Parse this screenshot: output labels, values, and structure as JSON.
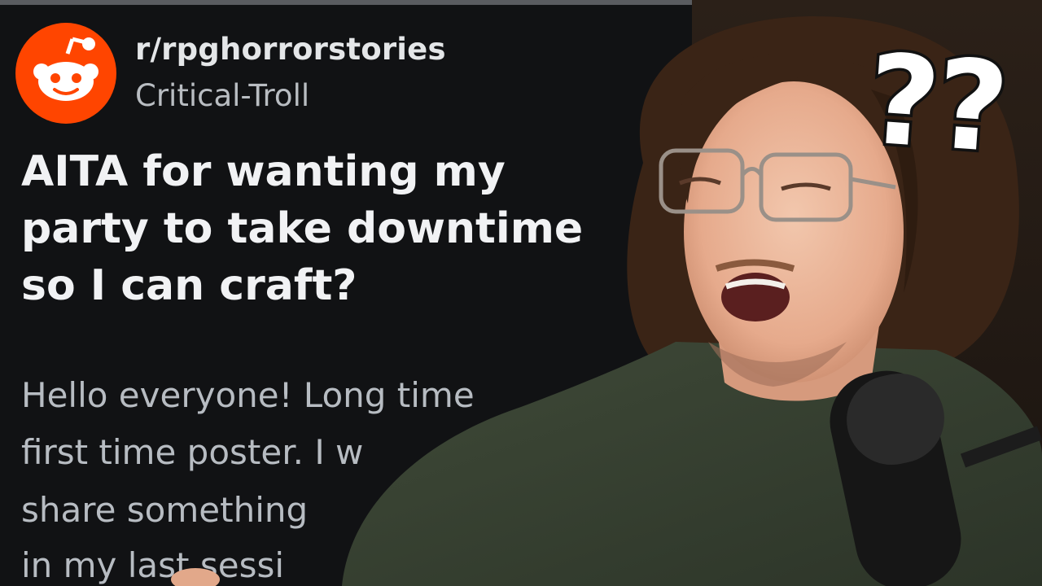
{
  "post": {
    "subreddit": "r/rpghorrorstories",
    "username": "Critical-Troll",
    "title_lines": [
      "AITA for wanting my",
      "party to take downtime",
      "so I can craft?"
    ],
    "body_lines": [
      "Hello everyone! Long time",
      "first time poster. I w",
      "share something",
      "in my last sessi"
    ],
    "avatar_icon": "reddit-snoo-icon",
    "avatar_color": "#ff4500"
  },
  "overlay": {
    "question_marks": "??"
  },
  "photo": {
    "subject": "man-with-glasses-at-microphone"
  }
}
